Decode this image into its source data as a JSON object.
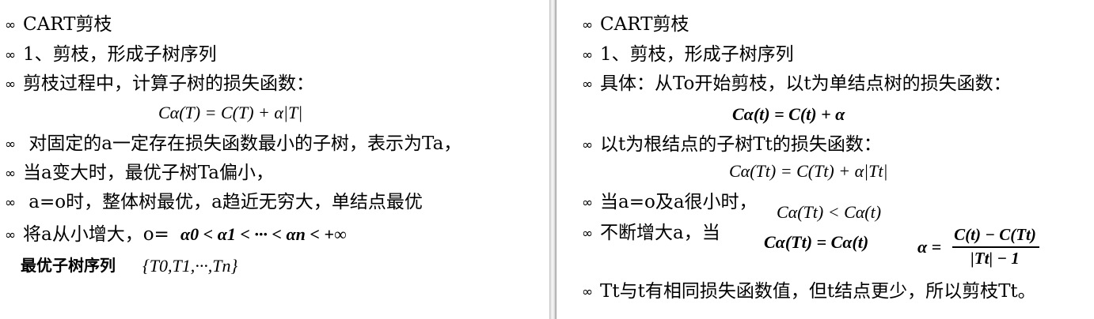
{
  "bullet_glyph": "∞",
  "left": {
    "title": "CART剪枝",
    "step": "1、剪枝，形成子树序列",
    "loss_intro": "剪枝过程中，计算子树的损失函数：",
    "loss_formula": "Cα(T) = C(T) + α|T|",
    "fixed_a": " 对固定的a一定存在损失函数最小的子树，表示为Ta，",
    "a_grows": "当a变大时，最优子树Ta偏小，",
    "extremes": " a=o时，整体树最优，a趋近无穷大，单结点最优",
    "increase": "将a从小增大，o=",
    "alpha_seq": "α0 < α1 < ··· < αn < +∞",
    "subtree_seq_label": "最优子树序列",
    "subtree_seq": "{T0,T1,···,Tn}"
  },
  "right": {
    "title": "CART剪枝",
    "step": "1、剪枝，形成子树序列",
    "specific": "具体：从To开始剪枝，以t为单结点树的损失函数：",
    "single_formula": "Cα(t) = C(t) + α",
    "root_intro": "以t为根结点的子树Tt的损失函数：",
    "root_formula": "Cα(Tt) = C(Tt) + α|Tt|",
    "small_a": "当a=o及a很小时，",
    "small_a_formula": "Cα(Tt) < Cα(t)",
    "increase_a": "不断增大a，当",
    "equal_formula": "Cα(Tt) = Cα(t)",
    "alpha_lhs": "α =",
    "alpha_num": "C(t) − C(Tt)",
    "alpha_den": "|Tt| − 1",
    "conclusion": "Tt与t有相同损失函数值，但t结点更少，所以剪枝Tt。"
  }
}
